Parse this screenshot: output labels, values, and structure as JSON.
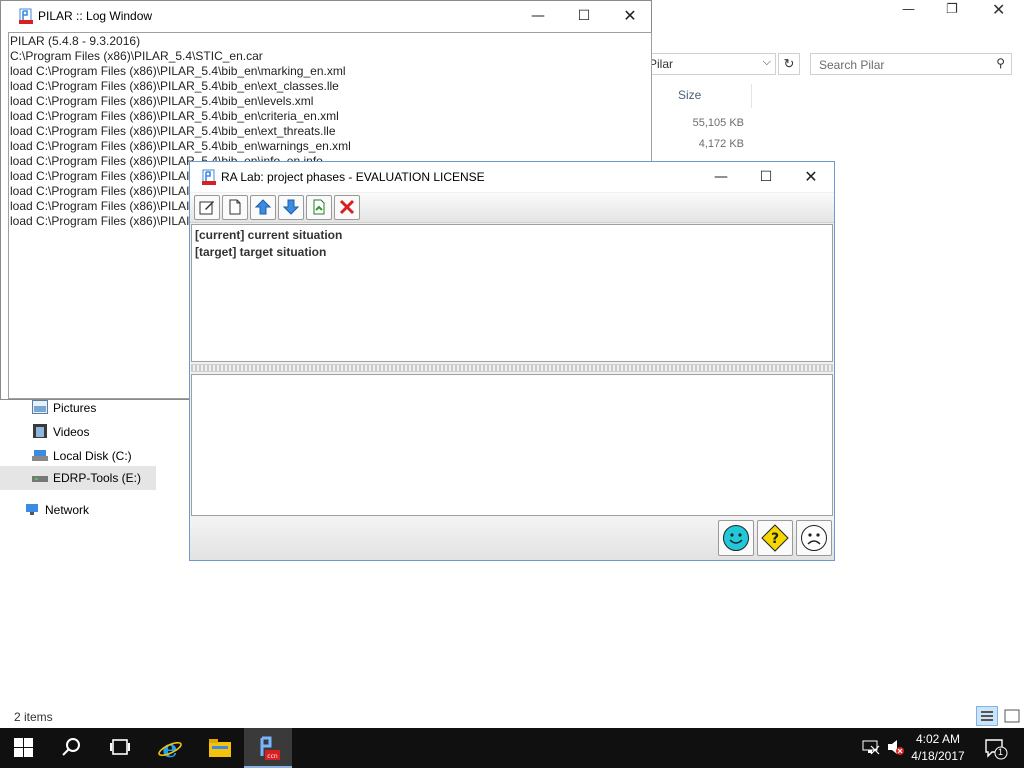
{
  "explorer": {
    "address_value": "Pilar",
    "search_placeholder": "Search Pilar",
    "column_size": "Size",
    "sizes": [
      "55,105 KB",
      "4,172 KB"
    ],
    "nav": {
      "pictures": "Pictures",
      "videos": "Videos",
      "local_disk": "Local Disk (C:)",
      "edrp": "EDRP-Tools (E:)",
      "network": "Network"
    },
    "status_items": "2 items"
  },
  "log_window": {
    "title": "PILAR :: Log Window",
    "lines": [
      "PILAR (5.4.8 - 9.3.2016)",
      "C:\\Program Files (x86)\\PILAR_5.4\\STIC_en.car",
      "load C:\\Program Files (x86)\\PILAR_5.4\\bib_en\\marking_en.xml",
      "load C:\\Program Files (x86)\\PILAR_5.4\\bib_en\\ext_classes.lle",
      "load C:\\Program Files (x86)\\PILAR_5.4\\bib_en\\levels.xml",
      "load C:\\Program Files (x86)\\PILAR_5.4\\bib_en\\criteria_en.xml",
      "load C:\\Program Files (x86)\\PILAR_5.4\\bib_en\\ext_threats.lle",
      "load C:\\Program Files (x86)\\PILAR_5.4\\bib_en\\warnings_en.xml",
      "load C:\\Program Files (x86)\\PILAR_5.4\\bib_en\\info_en.info",
      "load C:\\Program Files (x86)\\PILAI",
      "load C:\\Program Files (x86)\\PILAI",
      "load C:\\Program Files (x86)\\PILAI",
      "load C:\\Program Files (x86)\\PILAI"
    ]
  },
  "ra_window": {
    "title": "RA Lab: project phases - EVALUATION LICENSE",
    "phases": [
      "[current] current situation",
      "[target] target situation"
    ]
  },
  "taskbar": {
    "time": "4:02 AM",
    "date": "4/18/2017",
    "notification_count": "1"
  },
  "colors": {
    "taskbar_bg": "#101010",
    "accent_blue": "#3b8be0",
    "smiley_cyan": "#22c8d8",
    "question_yellow": "#f5d800",
    "delete_red": "#d92020"
  },
  "icons": [
    "windows-start-icon",
    "search-icon",
    "task-view-icon",
    "ie-icon",
    "file-explorer-icon",
    "pilar-icon",
    "happy-face-icon",
    "question-icon",
    "sad-face-icon"
  ]
}
